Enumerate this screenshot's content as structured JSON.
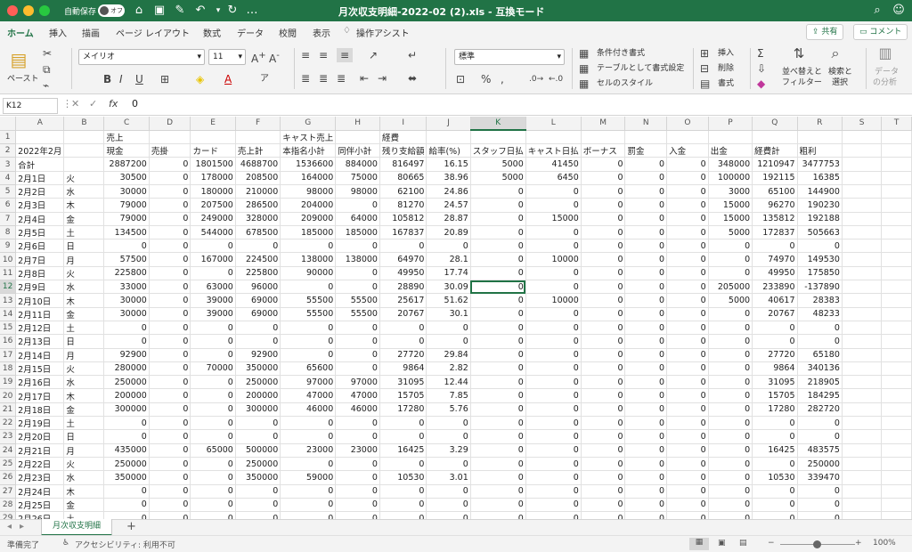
{
  "titlebar": {
    "autosave_label": "自動保存",
    "toggle_state": "オフ",
    "document_title": "月次収支明細-2022-02 (2).xls  -  互換モード"
  },
  "tabs": [
    "ホーム",
    "挿入",
    "描画",
    "ページ レイアウト",
    "数式",
    "データ",
    "校閲",
    "表示"
  ],
  "assist": "操作アシスト",
  "share_label": "共有",
  "comment_label": "コメント",
  "ribbon": {
    "paste_label": "ペースト",
    "font_name": "メイリオ",
    "font_size": "11",
    "number_format": "標準",
    "cond_format": "条件付き書式",
    "table_format": "テーブルとして書式設定",
    "cell_style": "セルのスタイル",
    "insert": "挿入",
    "delete": "削除",
    "format": "書式",
    "sort_filter_1": "並べ替えと",
    "sort_filter_2": "フィルター",
    "find_1": "検索と",
    "find_2": "選択",
    "analyze_1": "データ",
    "analyze_2": "の分析"
  },
  "formula": {
    "cell_ref": "K12",
    "content": "0"
  },
  "grid": {
    "columns": [
      "A",
      "B",
      "C",
      "D",
      "E",
      "F",
      "G",
      "H",
      "I",
      "J",
      "K",
      "L",
      "M",
      "N",
      "O",
      "P",
      "Q",
      "R",
      "S",
      "T"
    ],
    "rows": [
      [
        "",
        "",
        "売上",
        "",
        "",
        "",
        "キャスト売上",
        "",
        "経費",
        "",
        "",
        "",
        "",
        "",
        "",
        "",
        "",
        "",
        "",
        ""
      ],
      [
        "2022年2月",
        "",
        "現金",
        "売掛",
        "カード",
        "売上計",
        "本指名小計",
        "同伴小計",
        "残り支給額",
        "給率(%)",
        "スタッフ日払",
        "キャスト日払",
        "ボーナス",
        "罰金",
        "入金",
        "出金",
        "経費計",
        "粗利",
        "",
        ""
      ],
      [
        "合計",
        "",
        "2887200",
        "0",
        "1801500",
        "4688700",
        "1536600",
        "884000",
        "816497",
        "16.15",
        "5000",
        "41450",
        "0",
        "0",
        "0",
        "348000",
        "1210947",
        "3477753",
        "",
        ""
      ],
      [
        "2月1日",
        "火",
        "30500",
        "0",
        "178000",
        "208500",
        "164000",
        "75000",
        "80665",
        "38.96",
        "5000",
        "6450",
        "0",
        "0",
        "0",
        "100000",
        "192115",
        "16385",
        "",
        ""
      ],
      [
        "2月2日",
        "水",
        "30000",
        "0",
        "180000",
        "210000",
        "98000",
        "98000",
        "62100",
        "24.86",
        "0",
        "0",
        "0",
        "0",
        "0",
        "3000",
        "65100",
        "144900",
        "",
        ""
      ],
      [
        "2月3日",
        "木",
        "79000",
        "0",
        "207500",
        "286500",
        "204000",
        "0",
        "81270",
        "24.57",
        "0",
        "0",
        "0",
        "0",
        "0",
        "15000",
        "96270",
        "190230",
        "",
        ""
      ],
      [
        "2月4日",
        "金",
        "79000",
        "0",
        "249000",
        "328000",
        "209000",
        "64000",
        "105812",
        "28.87",
        "0",
        "15000",
        "0",
        "0",
        "0",
        "15000",
        "135812",
        "192188",
        "",
        ""
      ],
      [
        "2月5日",
        "土",
        "134500",
        "0",
        "544000",
        "678500",
        "185000",
        "185000",
        "167837",
        "20.89",
        "0",
        "0",
        "0",
        "0",
        "0",
        "5000",
        "172837",
        "505663",
        "",
        ""
      ],
      [
        "2月6日",
        "日",
        "0",
        "0",
        "0",
        "0",
        "0",
        "0",
        "0",
        "0",
        "0",
        "0",
        "0",
        "0",
        "0",
        "0",
        "0",
        "0",
        "",
        ""
      ],
      [
        "2月7日",
        "月",
        "57500",
        "0",
        "167000",
        "224500",
        "138000",
        "138000",
        "64970",
        "28.1",
        "0",
        "10000",
        "0",
        "0",
        "0",
        "0",
        "74970",
        "149530",
        "",
        ""
      ],
      [
        "2月8日",
        "火",
        "225800",
        "0",
        "0",
        "225800",
        "90000",
        "0",
        "49950",
        "17.74",
        "0",
        "0",
        "0",
        "0",
        "0",
        "0",
        "49950",
        "175850",
        "",
        ""
      ],
      [
        "2月9日",
        "水",
        "33000",
        "0",
        "63000",
        "96000",
        "0",
        "0",
        "28890",
        "30.09",
        "0",
        "0",
        "0",
        "0",
        "0",
        "205000",
        "233890",
        "-137890",
        "",
        ""
      ],
      [
        "2月10日",
        "木",
        "30000",
        "0",
        "39000",
        "69000",
        "55500",
        "55500",
        "25617",
        "51.62",
        "0",
        "10000",
        "0",
        "0",
        "0",
        "5000",
        "40617",
        "28383",
        "",
        ""
      ],
      [
        "2月11日",
        "金",
        "30000",
        "0",
        "39000",
        "69000",
        "55500",
        "55500",
        "20767",
        "30.1",
        "0",
        "0",
        "0",
        "0",
        "0",
        "0",
        "20767",
        "48233",
        "",
        ""
      ],
      [
        "2月12日",
        "土",
        "0",
        "0",
        "0",
        "0",
        "0",
        "0",
        "0",
        "0",
        "0",
        "0",
        "0",
        "0",
        "0",
        "0",
        "0",
        "0",
        "",
        ""
      ],
      [
        "2月13日",
        "日",
        "0",
        "0",
        "0",
        "0",
        "0",
        "0",
        "0",
        "0",
        "0",
        "0",
        "0",
        "0",
        "0",
        "0",
        "0",
        "0",
        "",
        ""
      ],
      [
        "2月14日",
        "月",
        "92900",
        "0",
        "0",
        "92900",
        "0",
        "0",
        "27720",
        "29.84",
        "0",
        "0",
        "0",
        "0",
        "0",
        "0",
        "27720",
        "65180",
        "",
        ""
      ],
      [
        "2月15日",
        "火",
        "280000",
        "0",
        "70000",
        "350000",
        "65600",
        "0",
        "9864",
        "2.82",
        "0",
        "0",
        "0",
        "0",
        "0",
        "0",
        "9864",
        "340136",
        "",
        ""
      ],
      [
        "2月16日",
        "水",
        "250000",
        "0",
        "0",
        "250000",
        "97000",
        "97000",
        "31095",
        "12.44",
        "0",
        "0",
        "0",
        "0",
        "0",
        "0",
        "31095",
        "218905",
        "",
        ""
      ],
      [
        "2月17日",
        "木",
        "200000",
        "0",
        "0",
        "200000",
        "47000",
        "47000",
        "15705",
        "7.85",
        "0",
        "0",
        "0",
        "0",
        "0",
        "0",
        "15705",
        "184295",
        "",
        ""
      ],
      [
        "2月18日",
        "金",
        "300000",
        "0",
        "0",
        "300000",
        "46000",
        "46000",
        "17280",
        "5.76",
        "0",
        "0",
        "0",
        "0",
        "0",
        "0",
        "17280",
        "282720",
        "",
        ""
      ],
      [
        "2月19日",
        "土",
        "0",
        "0",
        "0",
        "0",
        "0",
        "0",
        "0",
        "0",
        "0",
        "0",
        "0",
        "0",
        "0",
        "0",
        "0",
        "0",
        "",
        ""
      ],
      [
        "2月20日",
        "日",
        "0",
        "0",
        "0",
        "0",
        "0",
        "0",
        "0",
        "0",
        "0",
        "0",
        "0",
        "0",
        "0",
        "0",
        "0",
        "0",
        "",
        ""
      ],
      [
        "2月21日",
        "月",
        "435000",
        "0",
        "65000",
        "500000",
        "23000",
        "23000",
        "16425",
        "3.29",
        "0",
        "0",
        "0",
        "0",
        "0",
        "0",
        "16425",
        "483575",
        "",
        ""
      ],
      [
        "2月22日",
        "火",
        "250000",
        "0",
        "0",
        "250000",
        "0",
        "0",
        "0",
        "0",
        "0",
        "0",
        "0",
        "0",
        "0",
        "0",
        "0",
        "250000",
        "",
        ""
      ],
      [
        "2月23日",
        "水",
        "350000",
        "0",
        "0",
        "350000",
        "59000",
        "0",
        "10530",
        "3.01",
        "0",
        "0",
        "0",
        "0",
        "0",
        "0",
        "10530",
        "339470",
        "",
        ""
      ],
      [
        "2月24日",
        "木",
        "0",
        "0",
        "0",
        "0",
        "0",
        "0",
        "0",
        "0",
        "0",
        "0",
        "0",
        "0",
        "0",
        "0",
        "0",
        "0",
        "",
        ""
      ],
      [
        "2月25日",
        "金",
        "0",
        "0",
        "0",
        "0",
        "0",
        "0",
        "0",
        "0",
        "0",
        "0",
        "0",
        "0",
        "0",
        "0",
        "0",
        "0",
        "",
        ""
      ],
      [
        "2月26日",
        "土",
        "0",
        "0",
        "0",
        "0",
        "0",
        "0",
        "0",
        "0",
        "0",
        "0",
        "0",
        "0",
        "0",
        "0",
        "0",
        "0",
        "",
        ""
      ]
    ]
  },
  "sheet_tab": "月次収支明細",
  "status": {
    "ready": "準備完了",
    "accessibility": "アクセシビリティ: 利用不可",
    "zoom": "100%"
  }
}
